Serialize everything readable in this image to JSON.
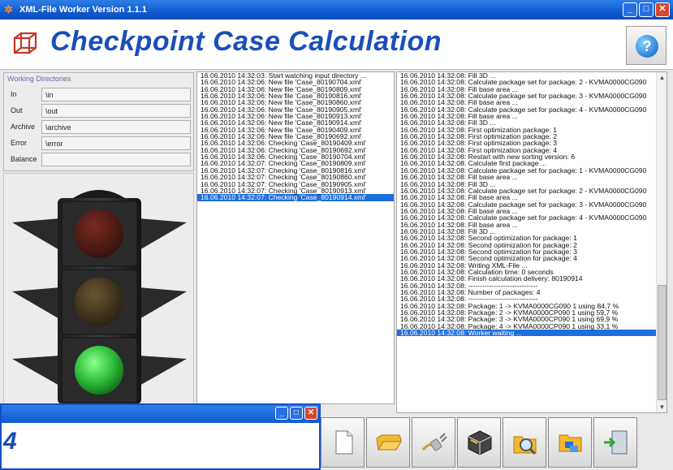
{
  "window": {
    "title": "XML-File Worker Version 1.1.1",
    "min": "_",
    "max": "□",
    "close": "✕"
  },
  "header": {
    "title": "Checkpoint Case Calculation",
    "help": "?"
  },
  "dirs": {
    "legend": "Working Directories",
    "rows": [
      {
        "label": "In",
        "value": "\\in"
      },
      {
        "label": "Out",
        "value": "\\out"
      },
      {
        "label": "Archive",
        "value": "\\archive"
      },
      {
        "label": "Error",
        "value": "\\error"
      },
      {
        "label": "Balance",
        "value": ""
      }
    ]
  },
  "traffic_light": {
    "active": "green"
  },
  "log_left": [
    "16.06.2010 14:32:03:  Start watching input directory ...",
    "16.06.2010 14:32:06:  New file 'Case_80190704.xml'",
    "16.06.2010 14:32:06:  New file 'Case_80190809.xml'",
    "16.06.2010 14:32:06:  New file 'Case_80190816.xml'",
    "16.06.2010 14:32:06:  New file 'Case_80190860.xml'",
    "16.06.2010 14:32:06:  New file 'Case_80190905.xml'",
    "16.06.2010 14:32:06:  New file 'Case_80190913.xml'",
    "16.06.2010 14:32:06:  New file 'Case_80190914.xml'",
    "16.06.2010 14:32:06:  New file 'Case_80190409.xml'",
    "16.06.2010 14:32:06:  New file 'Case_80190692.xml'",
    "16.06.2010 14:32:06:  Checking 'Case_80190409.xml'",
    "16.06.2010 14:32:06:  Checking 'Case_80190692.xml'",
    "16.06.2010 14:32:06:  Checking 'Case_80190704.xml'",
    "16.06.2010 14:32:07:  Checking 'Case_80190809.xml'",
    "16.06.2010 14:32:07:  Checking 'Case_80190816.xml'",
    "16.06.2010 14:32:07:  Checking 'Case_80190860.xml'",
    "16.06.2010 14:32:07:  Checking 'Case_80190905.xml'",
    "16.06.2010 14:32:07:  Checking 'Case_80190913.xml'",
    "16.06.2010 14:32:07:  Checking 'Case_80190914.xml'"
  ],
  "log_left_selected": 18,
  "log_right": [
    "16.06.2010 14:32:08:  Fill 3D ...",
    "16.06.2010 14:32:08:  Calculate package set for package: 2 - KVMA0000CG090",
    "16.06.2010 14:32:08:  Fill base area ...",
    "16.06.2010 14:32:08:  Calculate package set for package: 3 - KVMA0000CG090",
    "16.06.2010 14:32:08:  Fill base area ...",
    "16.06.2010 14:32:08:  Calculate package set for package: 4 - KVMA0000CG090",
    "16.06.2010 14:32:08:  Fill base area ...",
    "16.06.2010 14:32:08:  Fill 3D ...",
    "16.06.2010 14:32:08:  First optimization package: 1",
    "16.06.2010 14:32:08:  First optimization package: 2",
    "16.06.2010 14:32:08:  First optimization package: 3",
    "16.06.2010 14:32:08:  First optimization package: 4",
    "16.06.2010 14:32:08:  Restart with new sorting version: 6",
    "16.06.2010 14:32:08:  Calculate first package ...",
    "16.06.2010 14:32:08:  Calculate package set for package: 1 - KVMA0000CG090",
    "16.06.2010 14:32:08:  Fill base area ...",
    "16.06.2010 14:32:08:  Fill 3D ...",
    "16.06.2010 14:32:08:  Calculate package set for package: 2 - KVMA0000CG090",
    "16.06.2010 14:32:08:  Fill base area ...",
    "16.06.2010 14:32:08:  Calculate package set for package: 3 - KVMA0000CG090",
    "16.06.2010 14:32:08:  Fill base area ...",
    "16.06.2010 14:32:08:  Calculate package set for package: 4 - KVMA0000CG090",
    "16.06.2010 14:32:08:  Fill base area ...",
    "16.06.2010 14:32:08:  Fill 3D ...",
    "16.06.2010 14:32:08:  Second optimization for package: 1",
    "16.06.2010 14:32:08:  Second optimization for package: 2",
    "16.06.2010 14:32:08:  Second optimization for package: 3",
    "16.06.2010 14:32:08:  Second optimization for package: 4",
    "16.06.2010 14:32:08:  Writing XML-File ...",
    "16.06.2010 14:32:08:  Calculation time: 0 seconds",
    "16.06.2010 14:32:08:  Finish calculation delivery: 80190914",
    "16.06.2010 14:32:08:  ------------------------------",
    "16.06.2010 14:32:08:  Number of packages: 4",
    "16.06.2010 14:32:08:  ------------------------------",
    "16.06.2010 14:32:08:  Package: 1 -> KVMA0000CG090    1 using 84,7 %",
    "16.06.2010 14:32:08:  Package: 2 -> KVMA0000CP090    1 using 59,7 %",
    "16.06.2010 14:32:08:  Package: 3 -> KVMA0000CP090    1 using 69,9 %",
    "16.06.2010 14:32:08:  Package: 4 -> KVMA0000CP090    1 using 33,1 %",
    "",
    "",
    "",
    "",
    "",
    "16.06.2010 14:32:08:  Worker waiting ..."
  ],
  "log_right_selected": 43,
  "popup": {
    "title": "",
    "text": "4"
  },
  "toolbar": [
    {
      "icon": "new-document-icon"
    },
    {
      "icon": "open-folder-icon"
    },
    {
      "icon": "connect-plug-icon"
    },
    {
      "icon": "cube-icon"
    },
    {
      "icon": "search-folder-icon"
    },
    {
      "icon": "network-folder-icon"
    },
    {
      "icon": "exit-door-icon"
    }
  ],
  "colors": {
    "accent": "#1a4fb8",
    "titlebar": "#0f5bd2",
    "selection": "#1f6ee0"
  }
}
